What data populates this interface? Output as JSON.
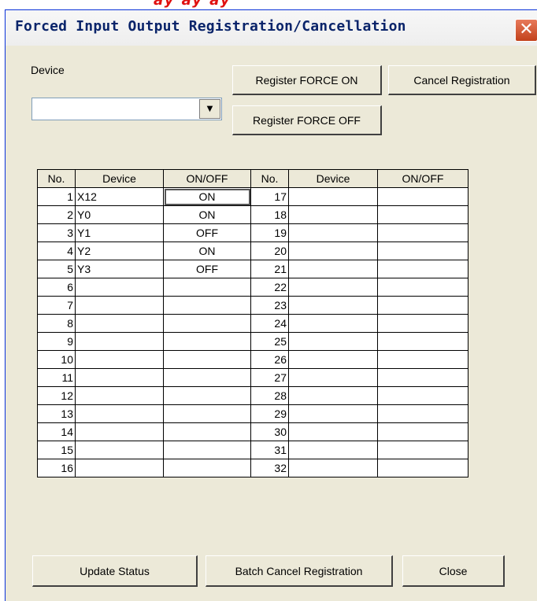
{
  "header_overlay": {
    "text": "ay ay ay"
  },
  "window": {
    "title": "Forced Input Output Registration/Cancellation",
    "close_glyph": "✕"
  },
  "device": {
    "label": "Device",
    "value": ""
  },
  "buttons": {
    "register_on": "Register FORCE ON",
    "register_off": "Register FORCE OFF",
    "cancel_registration": "Cancel Registration",
    "update_status": "Update Status",
    "batch_cancel": "Batch Cancel Registration",
    "close": "Close"
  },
  "table": {
    "headers": [
      "No.",
      "Device",
      "ON/OFF",
      "No.",
      "Device",
      "ON/OFF"
    ],
    "rows": [
      {
        "no": "1",
        "device": "X12",
        "onoff": "ON",
        "no2": "17",
        "device2": "",
        "onoff2": ""
      },
      {
        "no": "2",
        "device": "Y0",
        "onoff": "ON",
        "no2": "18",
        "device2": "",
        "onoff2": ""
      },
      {
        "no": "3",
        "device": "Y1",
        "onoff": "OFF",
        "no2": "19",
        "device2": "",
        "onoff2": ""
      },
      {
        "no": "4",
        "device": "Y2",
        "onoff": "ON",
        "no2": "20",
        "device2": "",
        "onoff2": ""
      },
      {
        "no": "5",
        "device": "Y3",
        "onoff": "OFF",
        "no2": "21",
        "device2": "",
        "onoff2": ""
      },
      {
        "no": "6",
        "device": "",
        "onoff": "",
        "no2": "22",
        "device2": "",
        "onoff2": ""
      },
      {
        "no": "7",
        "device": "",
        "onoff": "",
        "no2": "23",
        "device2": "",
        "onoff2": ""
      },
      {
        "no": "8",
        "device": "",
        "onoff": "",
        "no2": "24",
        "device2": "",
        "onoff2": ""
      },
      {
        "no": "9",
        "device": "",
        "onoff": "",
        "no2": "25",
        "device2": "",
        "onoff2": ""
      },
      {
        "no": "10",
        "device": "",
        "onoff": "",
        "no2": "26",
        "device2": "",
        "onoff2": ""
      },
      {
        "no": "11",
        "device": "",
        "onoff": "",
        "no2": "27",
        "device2": "",
        "onoff2": ""
      },
      {
        "no": "12",
        "device": "",
        "onoff": "",
        "no2": "28",
        "device2": "",
        "onoff2": ""
      },
      {
        "no": "13",
        "device": "",
        "onoff": "",
        "no2": "29",
        "device2": "",
        "onoff2": ""
      },
      {
        "no": "14",
        "device": "",
        "onoff": "",
        "no2": "30",
        "device2": "",
        "onoff2": ""
      },
      {
        "no": "15",
        "device": "",
        "onoff": "",
        "no2": "31",
        "device2": "",
        "onoff2": ""
      },
      {
        "no": "16",
        "device": "",
        "onoff": "",
        "no2": "32",
        "device2": "",
        "onoff2": ""
      }
    ]
  },
  "colors": {
    "title_text": "#0a246a",
    "close_button": "#d4502c",
    "dialog_bg": "#ece9d8"
  }
}
